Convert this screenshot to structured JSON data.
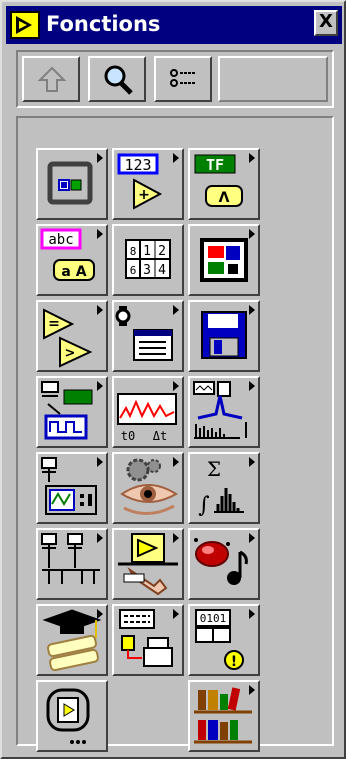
{
  "window": {
    "title": "Fonctions",
    "close_label": "X"
  },
  "toolbar": {
    "buttons": [
      {
        "name": "up-button",
        "icon": "up-arrow-icon"
      },
      {
        "name": "search-button",
        "icon": "magnifier-icon"
      },
      {
        "name": "options-button",
        "icon": "options-list-icon"
      }
    ]
  },
  "palette": {
    "items": [
      {
        "icon": "structures-icon",
        "submenu": true
      },
      {
        "icon": "numeric-icon",
        "label": "123",
        "submenu": true
      },
      {
        "icon": "boolean-icon",
        "label": "TF",
        "submenu": true
      },
      {
        "icon": "string-icon",
        "label": "abc",
        "submenu": true
      },
      {
        "icon": "array-cluster-icon",
        "submenu": false
      },
      {
        "icon": "cluster-icon",
        "submenu": true
      },
      {
        "icon": "comparison-icon",
        "submenu": true
      },
      {
        "icon": "time-dialog-icon",
        "submenu": true
      },
      {
        "icon": "file-io-icon",
        "submenu": true
      },
      {
        "icon": "data-acquisition-icon",
        "submenu": true
      },
      {
        "icon": "waveform-icon",
        "labels": [
          "t0",
          "Δt"
        ],
        "submenu": true
      },
      {
        "icon": "analyze-icon",
        "submenu": true
      },
      {
        "icon": "instrument-io-icon",
        "submenu": true
      },
      {
        "icon": "motion-vision-icon",
        "submenu": true
      },
      {
        "icon": "mathematics-icon",
        "label": "Σ",
        "submenu": true
      },
      {
        "icon": "communication-icon",
        "submenu": true
      },
      {
        "icon": "control-design-icon",
        "submenu": true
      },
      {
        "icon": "graphics-sound-icon",
        "submenu": true
      },
      {
        "icon": "tutorial-icon",
        "submenu": true
      },
      {
        "icon": "report-generation-icon",
        "submenu": true
      },
      {
        "icon": "advanced-icon",
        "label": "0101",
        "submenu": true
      },
      {
        "icon": "select-vi-icon",
        "submenu": false
      },
      {
        "icon": "user-libraries-icon",
        "submenu": true
      }
    ]
  }
}
